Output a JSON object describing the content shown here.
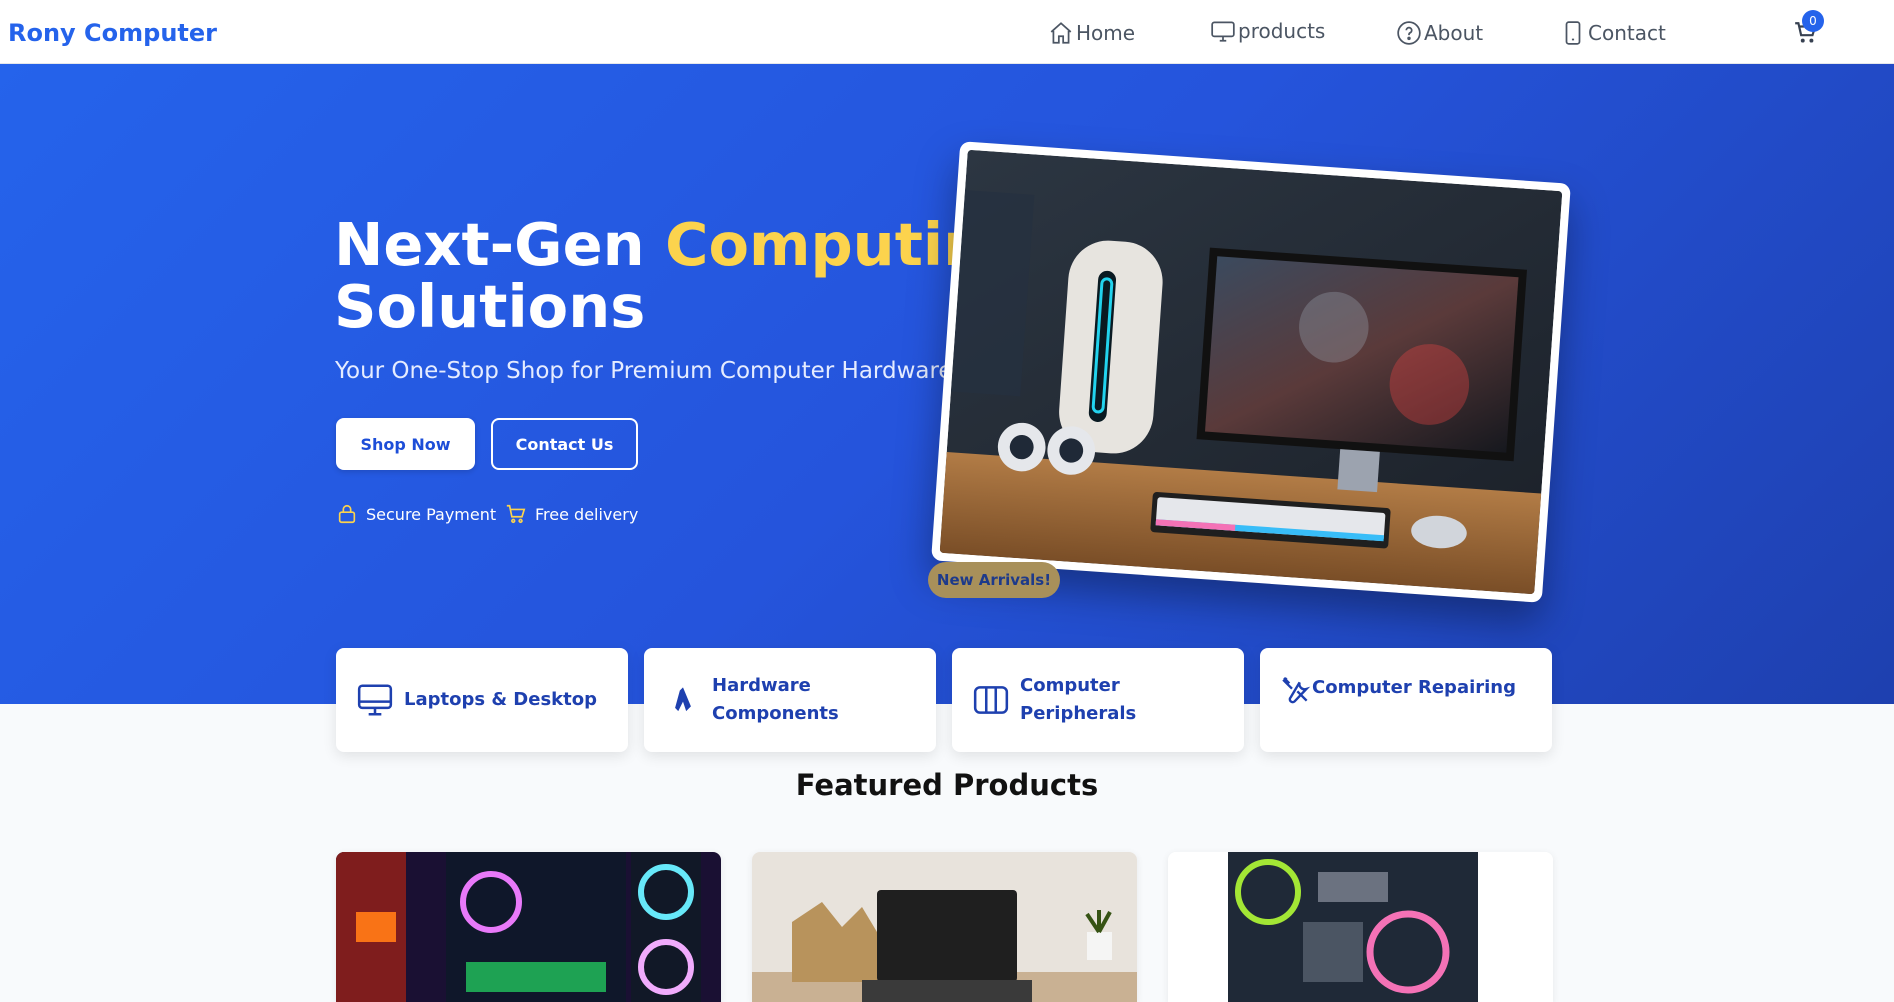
{
  "brand": "Rony Computer",
  "nav": {
    "home": "Home",
    "products": "products",
    "about": "About",
    "contact": "Contact",
    "cart_count": "0"
  },
  "hero": {
    "title_part1": "Next-Gen ",
    "title_accent": "Computing",
    "title_part2": "Solutions",
    "subtitle": "Your One-Stop Shop for Premium Computer Hardware",
    "shop_button": "Shop Now",
    "contact_button": "Contact Us",
    "features": [
      "Secure Payment",
      "Free delivery"
    ],
    "badge": "New Arrivals!"
  },
  "categories": [
    {
      "label": "Laptops & Desktop",
      "icon": "desktop-icon"
    },
    {
      "label": "Hardware Components",
      "icon": "hardware-icon"
    },
    {
      "label": "Computer Peripherals",
      "icon": "peripherals-icon"
    },
    {
      "label": "Computer Repairing",
      "icon": "repair-tools-icon"
    }
  ],
  "featured": {
    "title": "Featured Products"
  },
  "colors": {
    "primary": "#2563eb",
    "accent": "#fcd34d",
    "category_text": "#1e40af"
  }
}
